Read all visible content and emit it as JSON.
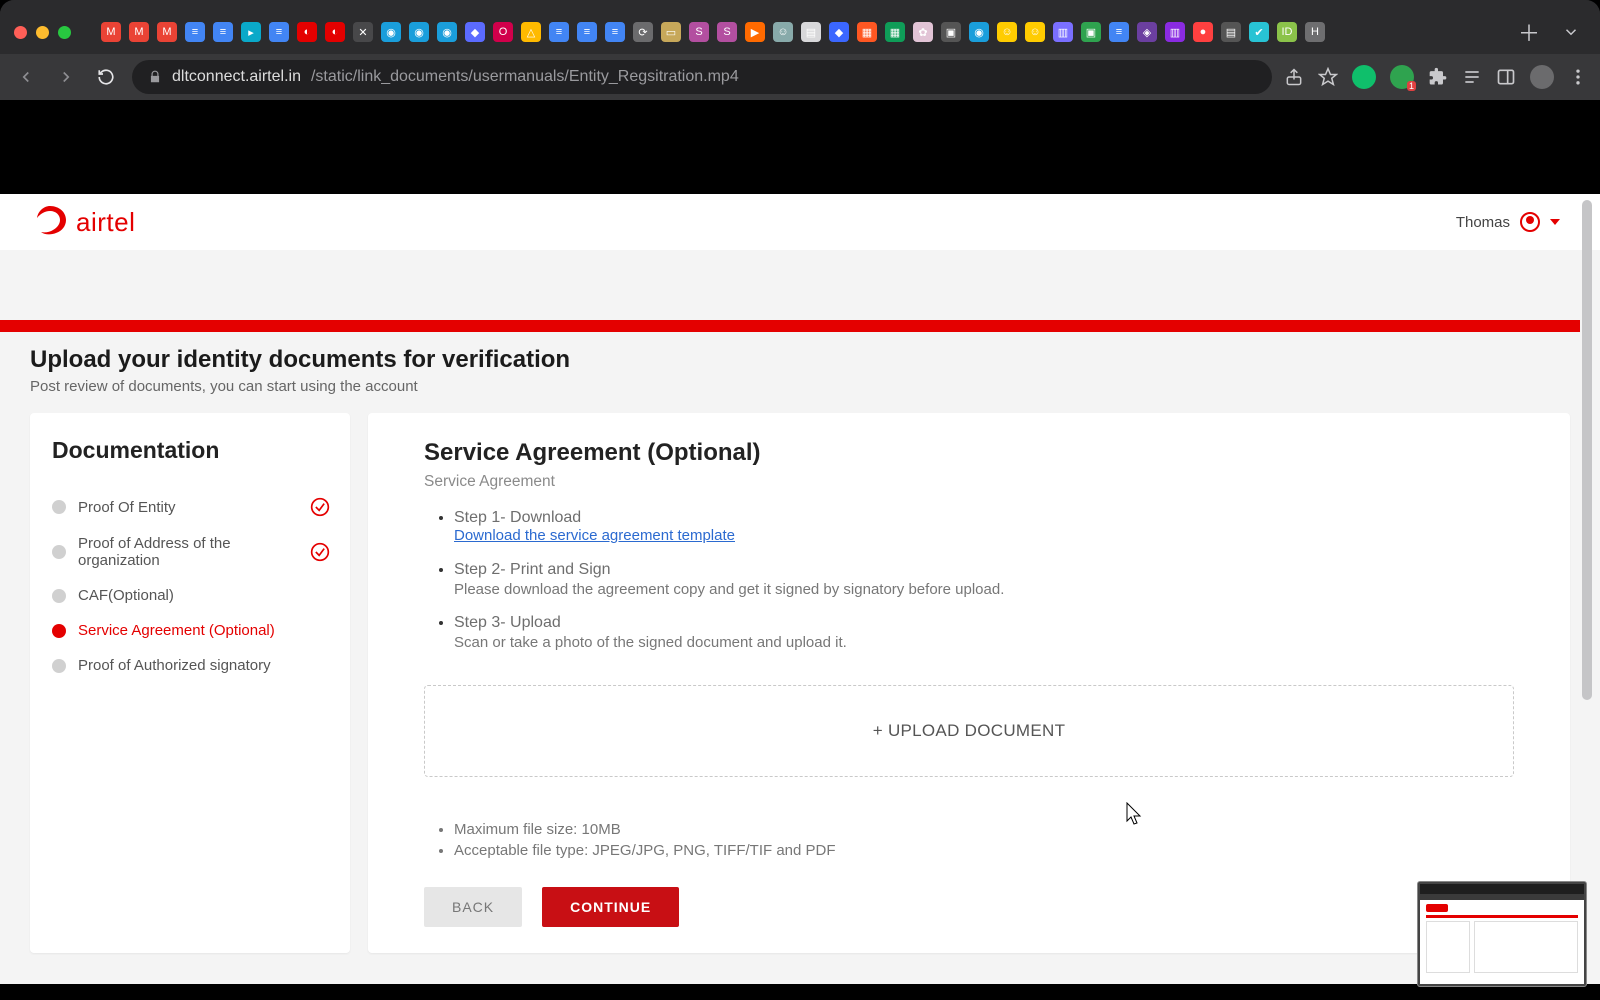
{
  "browser": {
    "url_host": "dltconnect.airtel.in",
    "url_path": "/static/link_documents/usermanuals/Entity_Regsitration.mp4"
  },
  "header": {
    "brand": "airtel",
    "user_name": "Thomas"
  },
  "title": {
    "heading": "Upload your identity documents for verification",
    "sub": "Post review of documents, you can start using the account"
  },
  "sidebar": {
    "heading": "Documentation",
    "items": [
      {
        "label": "Proof Of Entity",
        "done": true,
        "active": false
      },
      {
        "label": "Proof of Address of the organization",
        "done": true,
        "active": false
      },
      {
        "label": "CAF(Optional)",
        "done": false,
        "active": false
      },
      {
        "label": "Service Agreement (Optional)",
        "done": false,
        "active": true
      },
      {
        "label": "Proof of Authorized signatory",
        "done": false,
        "active": false
      }
    ]
  },
  "panel": {
    "heading": "Service Agreement (Optional)",
    "sub": "Service Agreement",
    "steps": [
      {
        "title": "Step 1- Download",
        "body": "Download the service agreement template",
        "body_is_link": true
      },
      {
        "title": "Step 2- Print and Sign",
        "body": "Please download the agreement copy and get it signed by signatory before upload.",
        "body_is_link": false
      },
      {
        "title": "Step 3- Upload",
        "body": "Scan or take a photo of the signed document and upload it.",
        "body_is_link": false
      }
    ],
    "upload_label": "+ UPLOAD DOCUMENT",
    "requirements": [
      "Maximum file size: 10MB",
      "Acceptable file type: JPEG/JPG, PNG, TIFF/TIF and PDF"
    ],
    "back_label": "BACK",
    "continue_label": "CONTINUE"
  }
}
